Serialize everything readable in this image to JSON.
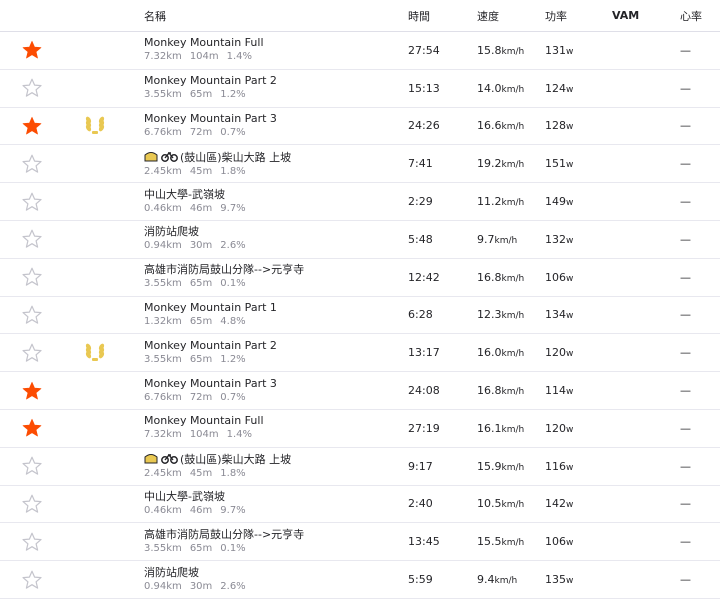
{
  "header": {
    "name": "名稱",
    "time": "時間",
    "speed": "速度",
    "power": "功率",
    "vam": "VAM",
    "hr": "心率"
  },
  "units": {
    "speed": "km/h",
    "power": "w"
  },
  "colors": {
    "star_filled": "#fc4c02",
    "star_outline": "#c4c4cc",
    "medal": "#e9c852"
  },
  "rows": [
    {
      "starred": true,
      "medal": false,
      "badges": false,
      "name": "Monkey Mountain Full",
      "dist": "7.32",
      "elev": "104",
      "grade": "1.4%",
      "time": "27:54",
      "speed": "15.8",
      "power": "131",
      "vam": "",
      "hr": "—"
    },
    {
      "starred": false,
      "medal": false,
      "badges": false,
      "name": "Monkey Mountain Part 2",
      "dist": "3.55",
      "elev": "65",
      "grade": "1.2%",
      "time": "15:13",
      "speed": "14.0",
      "power": "124",
      "vam": "",
      "hr": "—"
    },
    {
      "starred": true,
      "medal": true,
      "badges": false,
      "name": "Monkey Mountain Part 3",
      "dist": "6.76",
      "elev": "72",
      "grade": "0.7%",
      "time": "24:26",
      "speed": "16.6",
      "power": "128",
      "vam": "",
      "hr": "—"
    },
    {
      "starred": false,
      "medal": false,
      "badges": true,
      "name": "(鼓山區)柴山大路 上坡",
      "dist": "2.45",
      "elev": "45",
      "grade": "1.8%",
      "time": "7:41",
      "speed": "19.2",
      "power": "151",
      "vam": "",
      "hr": "—"
    },
    {
      "starred": false,
      "medal": false,
      "badges": false,
      "name": "中山大學-武嶺坡",
      "dist": "0.46",
      "elev": "46",
      "grade": "9.7%",
      "time": "2:29",
      "speed": "11.2",
      "power": "149",
      "vam": "",
      "hr": "—"
    },
    {
      "starred": false,
      "medal": false,
      "badges": false,
      "name": "消防站爬坡",
      "dist": "0.94",
      "elev": "30",
      "grade": "2.6%",
      "time": "5:48",
      "speed": "9.7",
      "power": "132",
      "vam": "",
      "hr": "—"
    },
    {
      "starred": false,
      "medal": false,
      "badges": false,
      "name": "高雄市消防局鼓山分隊-->元亨寺",
      "dist": "3.55",
      "elev": "65",
      "grade": "0.1%",
      "time": "12:42",
      "speed": "16.8",
      "power": "106",
      "vam": "",
      "hr": "—"
    },
    {
      "starred": false,
      "medal": false,
      "badges": false,
      "name": "Monkey Mountain Part 1",
      "dist": "1.32",
      "elev": "65",
      "grade": "4.8%",
      "time": "6:28",
      "speed": "12.3",
      "power": "134",
      "vam": "",
      "hr": "—"
    },
    {
      "starred": false,
      "medal": true,
      "badges": false,
      "name": "Monkey Mountain Part 2",
      "dist": "3.55",
      "elev": "65",
      "grade": "1.2%",
      "time": "13:17",
      "speed": "16.0",
      "power": "120",
      "vam": "",
      "hr": "—"
    },
    {
      "starred": true,
      "medal": false,
      "badges": false,
      "name": "Monkey Mountain Part 3",
      "dist": "6.76",
      "elev": "72",
      "grade": "0.7%",
      "time": "24:08",
      "speed": "16.8",
      "power": "114",
      "vam": "",
      "hr": "—"
    },
    {
      "starred": true,
      "medal": false,
      "badges": false,
      "name": "Monkey Mountain Full",
      "dist": "7.32",
      "elev": "104",
      "grade": "1.4%",
      "time": "27:19",
      "speed": "16.1",
      "power": "120",
      "vam": "",
      "hr": "—"
    },
    {
      "starred": false,
      "medal": false,
      "badges": true,
      "name": "(鼓山區)柴山大路 上坡",
      "dist": "2.45",
      "elev": "45",
      "grade": "1.8%",
      "time": "9:17",
      "speed": "15.9",
      "power": "116",
      "vam": "",
      "hr": "—"
    },
    {
      "starred": false,
      "medal": false,
      "badges": false,
      "name": "中山大學-武嶺坡",
      "dist": "0.46",
      "elev": "46",
      "grade": "9.7%",
      "time": "2:40",
      "speed": "10.5",
      "power": "142",
      "vam": "",
      "hr": "—"
    },
    {
      "starred": false,
      "medal": false,
      "badges": false,
      "name": "高雄市消防局鼓山分隊-->元亨寺",
      "dist": "3.55",
      "elev": "65",
      "grade": "0.1%",
      "time": "13:45",
      "speed": "15.5",
      "power": "106",
      "vam": "",
      "hr": "—"
    },
    {
      "starred": false,
      "medal": false,
      "badges": false,
      "name": "消防站爬坡",
      "dist": "0.94",
      "elev": "30",
      "grade": "2.6%",
      "time": "5:59",
      "speed": "9.4",
      "power": "135",
      "vam": "",
      "hr": "—"
    }
  ]
}
